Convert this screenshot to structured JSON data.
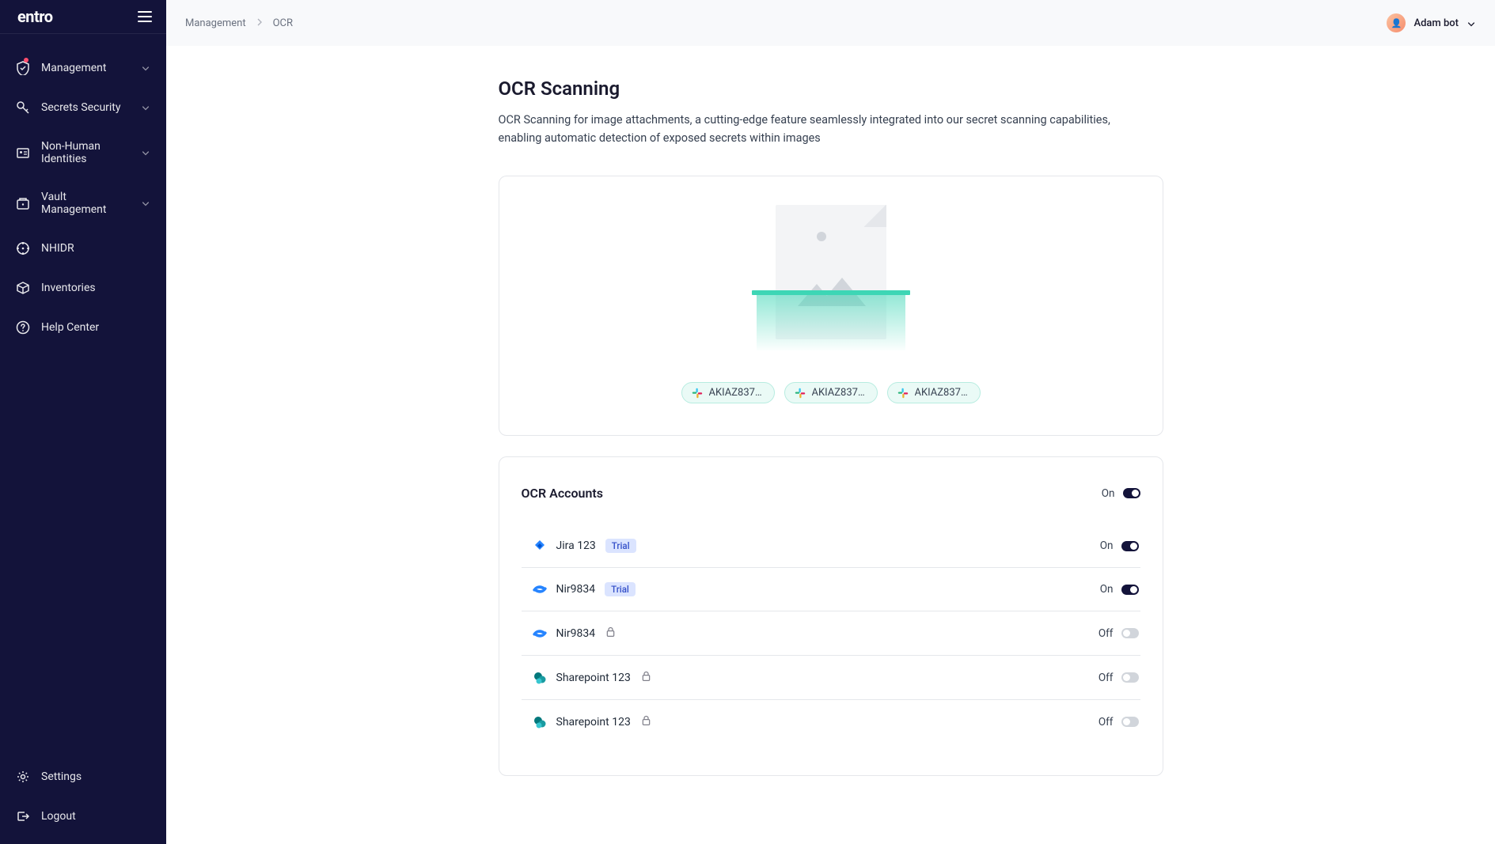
{
  "brand": "entro",
  "user": {
    "name": "Adam bot"
  },
  "breadcrumb": {
    "root": "Management",
    "leaf": "OCR"
  },
  "sidebar": {
    "items": [
      {
        "label": "Management",
        "icon": "shield-check",
        "chevron": true,
        "dot": true
      },
      {
        "label": "Secrets Security",
        "icon": "key",
        "chevron": true
      },
      {
        "label": "Non-Human Identities",
        "icon": "id-card",
        "chevron": true
      },
      {
        "label": "Vault Management",
        "icon": "vault",
        "chevron": true
      },
      {
        "label": "NHIDR",
        "icon": "target",
        "chevron": false
      },
      {
        "label": "Inventories",
        "icon": "box",
        "chevron": false
      },
      {
        "label": "Help Center",
        "icon": "help",
        "chevron": false
      }
    ],
    "footer": [
      {
        "label": "Settings",
        "icon": "gear"
      },
      {
        "label": "Logout",
        "icon": "logout"
      }
    ]
  },
  "page": {
    "title": "OCR Scanning",
    "description": "OCR Scanning for image attachments, a cutting-edge feature seamlessly integrated into our secret scanning capabilities, enabling automatic detection of exposed secrets within images"
  },
  "tokens": [
    {
      "label": "AKIAZ837FG…"
    },
    {
      "label": "AKIAZ837FG…"
    },
    {
      "label": "AKIAZ837FG…"
    }
  ],
  "accounts": {
    "section_title": "OCR Accounts",
    "master_state": "On",
    "master_on": true,
    "rows": [
      {
        "name": "Jira 123",
        "service": "jira",
        "trial": true,
        "locked": false,
        "state": "On",
        "on": true
      },
      {
        "name": "Nir9834",
        "service": "confluence",
        "trial": true,
        "locked": false,
        "state": "On",
        "on": true
      },
      {
        "name": "Nir9834",
        "service": "confluence",
        "trial": false,
        "locked": true,
        "state": "Off",
        "on": false
      },
      {
        "name": "Sharepoint 123",
        "service": "sharepoint",
        "trial": false,
        "locked": true,
        "state": "Off",
        "on": false
      },
      {
        "name": "Sharepoint 123",
        "service": "sharepoint",
        "trial": false,
        "locked": true,
        "state": "Off",
        "on": false
      }
    ]
  },
  "labels": {
    "trial": "Trial"
  }
}
